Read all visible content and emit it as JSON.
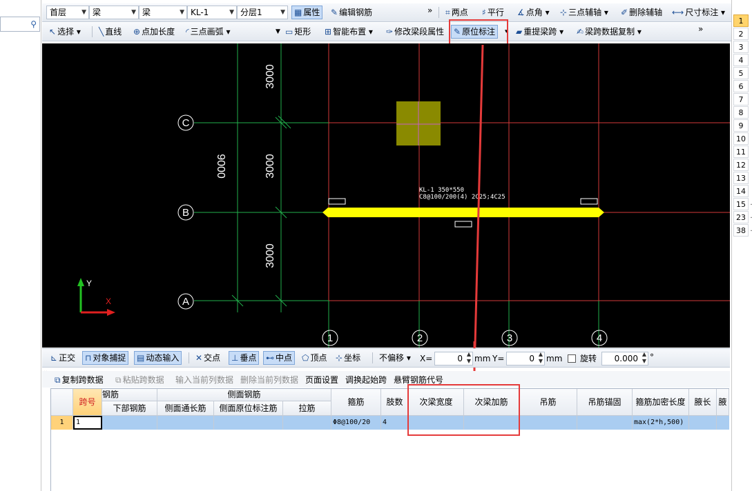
{
  "toolbar1": {
    "floor": "首层",
    "type1": "梁",
    "type2": "梁",
    "member": "KL-1",
    "layer": "分层1",
    "property_label": "属性",
    "edit_rebar_label": "编辑钢筋",
    "more": "»",
    "two_point_label": "两点",
    "parallel_label": "平行",
    "point_angle_label": "点角",
    "three_point_axis_label": "三点辅轴",
    "delete_axis_label": "删除辅轴",
    "dimension_label": "尺寸标注"
  },
  "toolbar2": {
    "select_label": "选择",
    "line_label": "直线",
    "point_length_label": "点加长度",
    "arc_label": "三点画弧",
    "rect_label": "矩形",
    "smart_layout_label": "智能布置",
    "modify_span_label": "修改梁段属性",
    "inplace_label": "原位标注",
    "recalc_span_label": "重提梁跨",
    "span_copy_label": "梁跨数据复制",
    "more": "»"
  },
  "cad": {
    "axis_rows": [
      "C",
      "B",
      "A"
    ],
    "axis_cols": [
      "1",
      "2",
      "3",
      "4"
    ],
    "dim_3000_top": "3000",
    "dim_3000_mid": "3000",
    "dim_3000_bot": "3000",
    "dim_9000": "9000",
    "beam_label_line1": "KL-1 350*550",
    "beam_label_line2": "C8@100/200(4) 2C25;4C25",
    "ucs_y": "Y",
    "ucs_x": "X"
  },
  "snapbar": {
    "ortho_label": "正交",
    "snap_label": "对象捕捉",
    "dynamic_input_label": "动态输入",
    "intersection_label": "交点",
    "perpendicular_label": "垂点",
    "midpoint_label": "中点",
    "vertex_label": "顶点",
    "coord_label": "坐标",
    "offset_mode": "不偏移",
    "x_label": "X=",
    "x_value": "0",
    "x_unit": "mm",
    "y_label": "Y=",
    "y_value": "0",
    "y_unit": "mm",
    "rotate_label": "旋转",
    "rotate_value": "0.000",
    "rotate_unit": "°"
  },
  "actions": {
    "copy_span": "复制跨数据",
    "paste_span": "粘贴跨数据",
    "input_col": "输入当前列数据",
    "delete_col": "删除当前列数据",
    "page_setup": "页面设置",
    "swap_start": "调换起始跨",
    "cantilever_code": "悬臂钢筋代号"
  },
  "table": {
    "h_span": "跨号",
    "h_rebar_partial": "钢筋",
    "h_bottom_rebar": "下部钢筋",
    "h_side_rebar": "侧面钢筋",
    "h_side_through": "侧面通长筋",
    "h_side_inplace": "侧面原位标注筋",
    "h_tie": "拉筋",
    "h_stirrup": "箍筋",
    "h_legs": "肢数",
    "h_sec_width": "次梁宽度",
    "h_sec_add": "次梁加筋",
    "h_hanger": "吊筋",
    "h_hanger_anchor": "吊筋锚固",
    "h_dense_len": "箍筋加密长度",
    "h_haunch_len": "腋长",
    "h_haunch2": "腋",
    "row_num": "1",
    "row_span": "1",
    "row_stirrup": "Φ8@100/20",
    "row_legs": "4",
    "row_dense": "max(2*h,500)"
  },
  "right_rows": [
    "1",
    "2",
    "3",
    "4",
    "5",
    "6",
    "7",
    "8",
    "9",
    "10",
    "11",
    "12",
    "13",
    "14",
    "15",
    "23",
    "38"
  ]
}
